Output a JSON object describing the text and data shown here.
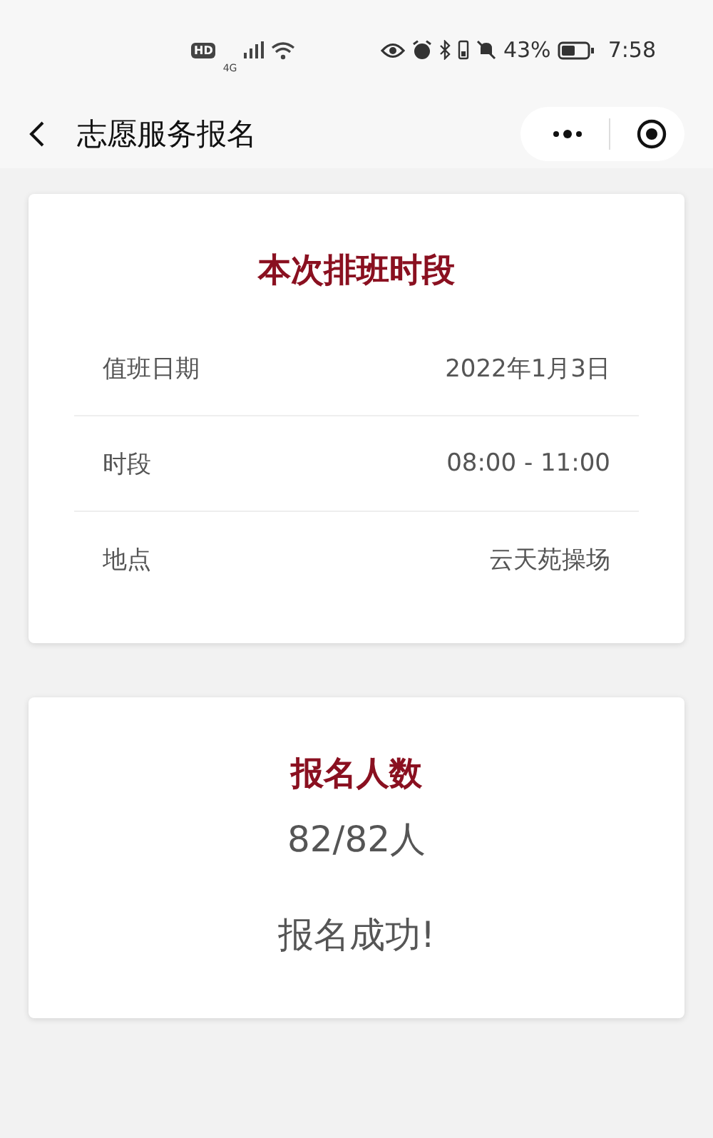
{
  "status_bar": {
    "hd_badge": "HD",
    "network": "4G",
    "battery_percent": "43%",
    "time": "7:58"
  },
  "nav_bar": {
    "title": "志愿服务报名"
  },
  "shift_card": {
    "title": "本次排班时段",
    "rows": [
      {
        "label": "值班日期",
        "value": "2022年1月3日"
      },
      {
        "label": "时段",
        "value": "08:00 - 11:00"
      },
      {
        "label": "地点",
        "value": "云天苑操场"
      }
    ]
  },
  "signup_card": {
    "title": "报名人数",
    "count": "82/82人",
    "message": "报名成功!"
  }
}
